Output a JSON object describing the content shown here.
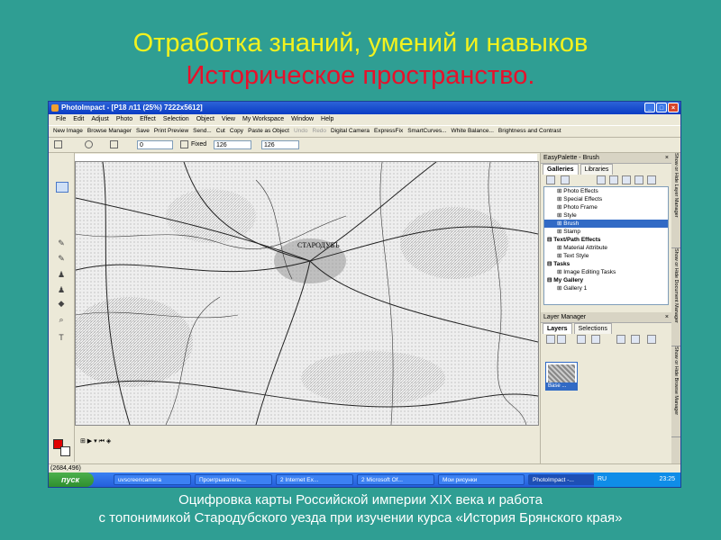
{
  "slide": {
    "title_line1": "Отработка знаний, умений и навыков",
    "title_line2": "Историческое пространство.",
    "caption_line1": "Оцифровка карты Российской империи XIX века и работа",
    "caption_line2": "с топонимикой Стародубского уезда при изучении курса «История Брянского края»"
  },
  "window": {
    "title": "PhotoImpact - [P18 л11 (25%) 7222x5612]",
    "menu": [
      "File",
      "Edit",
      "Adjust",
      "Photo",
      "Effect",
      "Selection",
      "Object",
      "View",
      "My Workspace",
      "Window",
      "Help"
    ],
    "toolbar": [
      "New Image",
      "Browse Manager",
      "Save",
      "Print Preview",
      "Send...",
      "Cut",
      "Copy",
      "Paste as Object",
      "Undo",
      "Redo",
      "Digital Camera",
      "ExpressFix",
      "SmartCurves...",
      "White Balance...",
      "Brightness and Contrast"
    ],
    "toolbar_disabled": [
      "Undo",
      "Redo"
    ],
    "attr": {
      "value0": "0",
      "fixed_label": "Fixed",
      "width": "126",
      "height": "126"
    },
    "status_coords": "(2684,496)",
    "map_label": "СТАРОДУБЪ"
  },
  "easypalette": {
    "title": "EasyPalette - Brush",
    "tabs": [
      "Galleries",
      "Libraries"
    ],
    "tree": [
      {
        "label": "Photo Effects",
        "type": "item"
      },
      {
        "label": "Special Effects",
        "type": "item"
      },
      {
        "label": "Photo Frame",
        "type": "item"
      },
      {
        "label": "Style",
        "type": "item"
      },
      {
        "label": "Brush",
        "type": "selected"
      },
      {
        "label": "Stamp",
        "type": "item"
      },
      {
        "label": "Text/Path Effects",
        "type": "hdr"
      },
      {
        "label": "Material Attribute",
        "type": "item"
      },
      {
        "label": "Text Style",
        "type": "item"
      },
      {
        "label": "Tasks",
        "type": "hdr"
      },
      {
        "label": "Image Editing Tasks",
        "type": "item"
      },
      {
        "label": "My Gallery",
        "type": "hdr"
      },
      {
        "label": "Gallery 1",
        "type": "item"
      }
    ]
  },
  "layer_manager": {
    "title": "Layer Manager",
    "tabs": [
      "Layers",
      "Selections"
    ],
    "layer_name": "Base ..."
  },
  "side_tabs": [
    "Show or Hide Layer Manager",
    "Show or Hide Document Manager",
    "Show or Hide Browse Manager"
  ],
  "taskbar": {
    "start": "пуск",
    "items": [
      "uvscreencamera",
      "Проигрыватель...",
      "2 Internet Ex...",
      "2 Microsoft Of...",
      "Мои рисунки",
      "PhotoImpact -..."
    ],
    "lang": "RU",
    "clock": "23:25"
  },
  "colors": {
    "background": "#2f9e93",
    "title_line1": "#f2f21e",
    "title_line2": "#e8102a",
    "caption": "#ffffff"
  }
}
